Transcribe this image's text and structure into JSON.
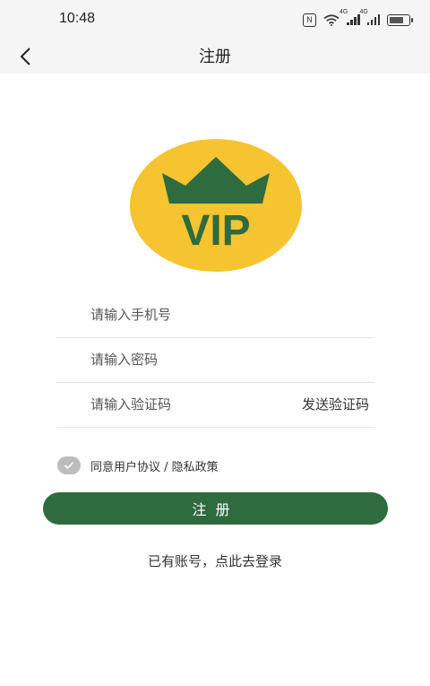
{
  "status_bar": {
    "time": "10:48",
    "network_label_1": "4G",
    "network_label_2": "4G"
  },
  "header": {
    "title": "注册"
  },
  "logo": {
    "text": "VIP",
    "bg_color": "#f5c430",
    "crown_color": "#2e6b3e"
  },
  "form": {
    "phone": {
      "placeholder": "请输入手机号",
      "value": ""
    },
    "password": {
      "placeholder": "请输入密码",
      "value": ""
    },
    "code": {
      "placeholder": "请输入验证码",
      "value": ""
    },
    "send_code_label": "发送验证码"
  },
  "agreement": {
    "text": "同意用户协议 / 隐私政策",
    "checked": true
  },
  "register_button": {
    "label": "注册"
  },
  "login_link": {
    "text": "已有账号，点此去登录"
  },
  "colors": {
    "accent": "#2e6b3e",
    "nav_bg": "#f5f5f5",
    "check_bg": "#bdbdbd"
  }
}
